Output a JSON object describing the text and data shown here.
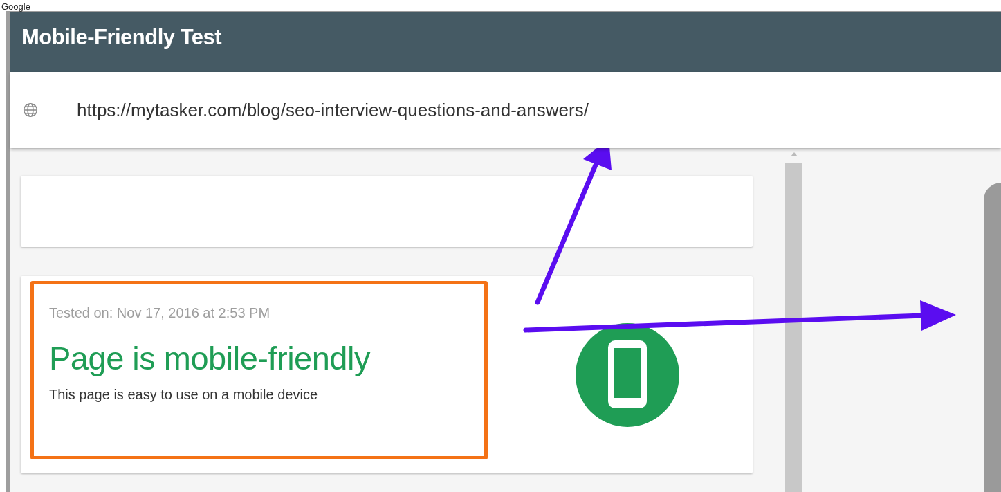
{
  "page_label": "Google",
  "header": {
    "title": "Mobile-Friendly Test"
  },
  "url_field": {
    "value": "https://mytasker.com/blog/seo-interview-questions-and-answers/"
  },
  "result": {
    "tested_on": "Tested on: Nov 17, 2016 at 2:53 PM",
    "verdict": "Page is mobile-friendly",
    "description": "This page is easy to use on a mobile device",
    "mobile_friendly": true
  }
}
